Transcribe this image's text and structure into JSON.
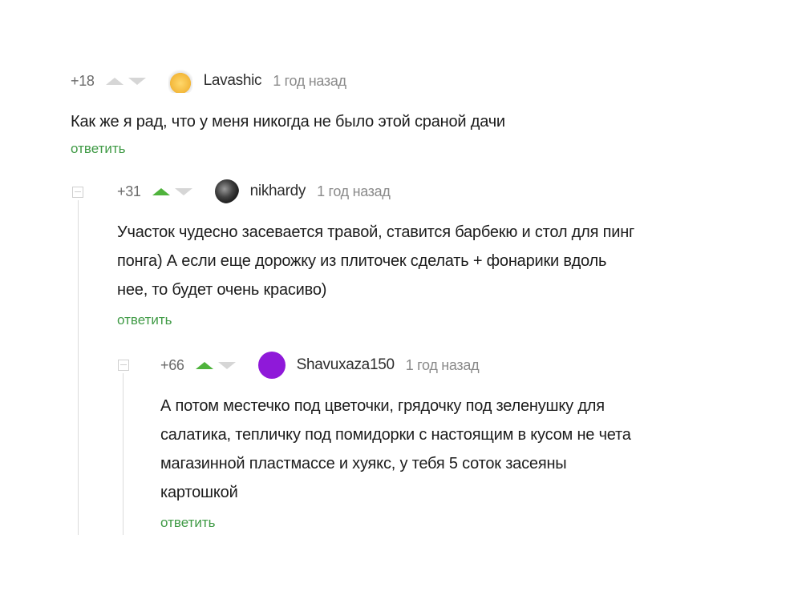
{
  "comments": [
    {
      "rating": "+18",
      "author": "Lavashic",
      "time": "1 год назад",
      "text": "Как же я рад, что у меня никогда не было этой сраной дачи",
      "reply_label": "ответить",
      "upvote_active": false
    },
    {
      "rating": "+31",
      "author": "nikhardy",
      "time": "1 год назад",
      "text_lines": [
        "Участок чудесно засевается травой, ставится барбекю и стол для пинг",
        "понга) А если еще дорожку из плиточек сделать + фонарики вдоль",
        "нее, то будет очень красиво)"
      ],
      "reply_label": "ответить",
      "upvote_active": true
    },
    {
      "rating": "+66",
      "author": "Shavuxaza150",
      "time": "1 год назад",
      "text_lines": [
        "А потом местечко под цветочки, грядочку под зеленушку для",
        "салатика, тепличку под помидорки с настоящим в кусом не чета",
        "магазинной пластмассе и хуякс, у тебя 5 соток засеяны",
        "картошкой"
      ],
      "reply_label": "ответить",
      "upvote_active": true
    }
  ],
  "colors": {
    "reply_green": "#3f9a45",
    "upvote_green": "#4fb33c",
    "avatar_purple": "#8f19d9"
  },
  "icons": {
    "upvote": "triangle-up-icon",
    "downvote": "triangle-down-icon",
    "collapse": "collapse-minus-icon"
  }
}
